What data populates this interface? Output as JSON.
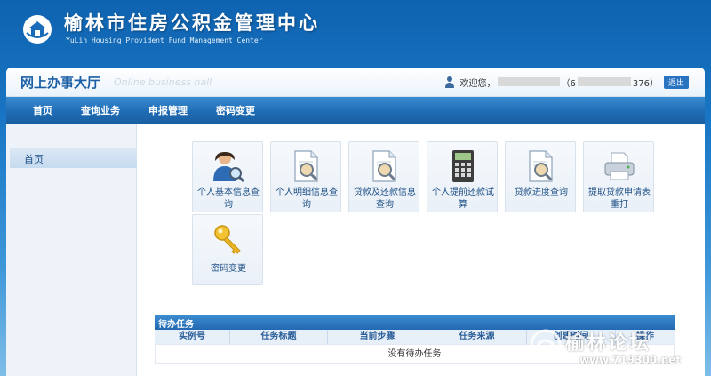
{
  "banner": {
    "title": "榆林市住房公积金管理中心",
    "subtitle": "YuLin Housing Provident Fund Management Center"
  },
  "header": {
    "hall_title": "网上办事大厅",
    "hall_en": "Online business hall",
    "welcome_prefix": "欢迎您，",
    "account_open": "（6",
    "account_close": "376）",
    "logout_label": "退出"
  },
  "nav": [
    "首页",
    "查询业务",
    "申报管理",
    "密码变更"
  ],
  "sidebar": {
    "items": [
      {
        "label": "首页"
      }
    ]
  },
  "tiles": [
    {
      "label": "个人基本信息查询",
      "icon": "person-search-icon"
    },
    {
      "label": "个人明细信息查询",
      "icon": "document-search-icon"
    },
    {
      "label": "贷款及还款信息查询",
      "icon": "document-search-icon"
    },
    {
      "label": "个人提前还款试算",
      "icon": "calculator-icon"
    },
    {
      "label": "贷款进度查询",
      "icon": "document-search-icon"
    },
    {
      "label": "提取贷款申请表重打",
      "icon": "printer-icon"
    },
    {
      "label": "密码变更",
      "icon": "key-icon"
    }
  ],
  "tasks": {
    "title": "待办任务",
    "columns": [
      "实例号",
      "任务标题",
      "当前步骤",
      "任务来源",
      "创建时间",
      "操作"
    ],
    "empty_text": "没有待办任务"
  },
  "watermark": {
    "text": "榆林论坛",
    "url": "www.719300.net"
  },
  "colors": {
    "nav_blue": "#1f6cb5",
    "accent_blue": "#2a73c0",
    "title_blue": "#1b5fa6"
  }
}
